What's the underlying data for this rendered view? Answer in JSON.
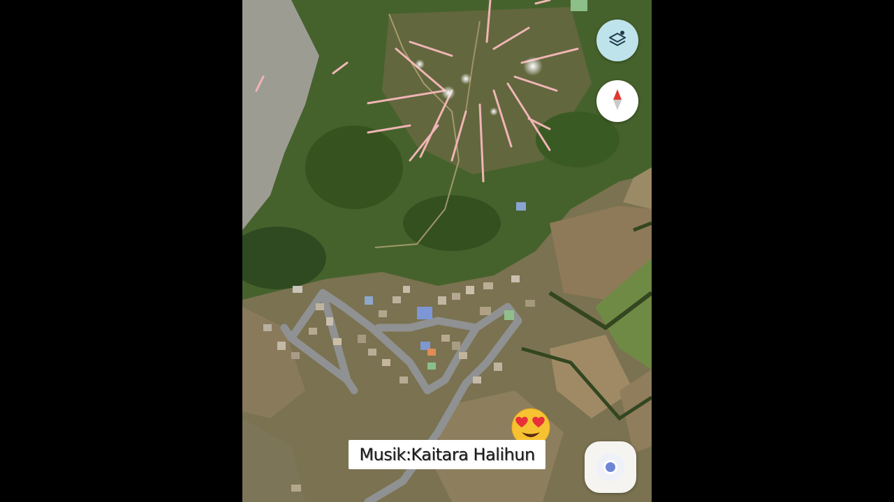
{
  "map": {
    "view": "satellite",
    "theme_colors": {
      "forest": "#3f5e2a",
      "field": "#8c7a52",
      "road": "#8d8f90",
      "roof": "#b8a58a"
    }
  },
  "controls": {
    "layers": {
      "icon": "layers-icon"
    },
    "compass": {
      "icon": "compass-icon"
    },
    "my_location": {
      "icon": "my-location-icon"
    }
  },
  "overlay": {
    "caption": "Musik:Kaitara Halihun",
    "emoji": "heart-eyes-emoji"
  }
}
